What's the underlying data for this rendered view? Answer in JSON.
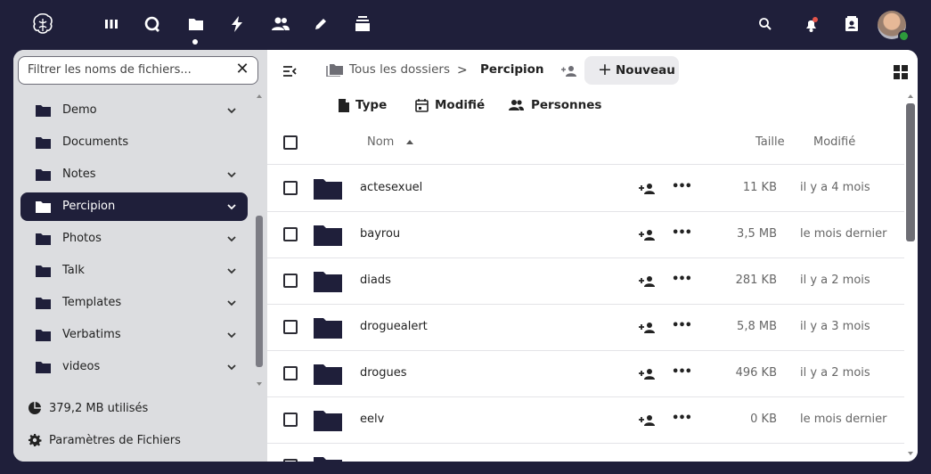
{
  "topbar": {
    "apps": [
      {
        "name": "logo"
      },
      {
        "name": "dashboard"
      },
      {
        "name": "search-unified"
      },
      {
        "name": "files"
      },
      {
        "name": "activity"
      },
      {
        "name": "contacts"
      },
      {
        "name": "notes"
      },
      {
        "name": "deck"
      }
    ],
    "right": [
      "search",
      "notifications",
      "contacts-menu",
      "user-avatar"
    ]
  },
  "sidebar": {
    "filter_placeholder": "Filtrer les noms de fichiers...",
    "items": [
      {
        "label": "Demo",
        "has_children": true
      },
      {
        "label": "Documents",
        "has_children": false
      },
      {
        "label": "Notes",
        "has_children": true
      },
      {
        "label": "Percipion",
        "has_children": true,
        "active": true
      },
      {
        "label": "Photos",
        "has_children": true
      },
      {
        "label": "Talk",
        "has_children": true
      },
      {
        "label": "Templates",
        "has_children": true
      },
      {
        "label": "Verbatims",
        "has_children": true
      },
      {
        "label": "videos",
        "has_children": true
      }
    ],
    "quota": "379,2 MB utilisés",
    "settings": "Paramètres de Fichiers"
  },
  "breadcrumb": {
    "root": "Tous les dossiers",
    "separator": ">",
    "current": "Percipion",
    "new_button": "Nouveau",
    "new_plus": "+"
  },
  "filters": {
    "type": "Type",
    "modified": "Modifié",
    "people": "Personnes"
  },
  "table": {
    "headers": {
      "name": "Nom",
      "size": "Taille",
      "modified": "Modifié"
    },
    "rows": [
      {
        "name": "actesexuel",
        "size": "11 KB",
        "modified": "il y a 4 mois"
      },
      {
        "name": "bayrou",
        "size": "3,5 MB",
        "modified": "le mois dernier"
      },
      {
        "name": "diads",
        "size": "281 KB",
        "modified": "il y a 2 mois"
      },
      {
        "name": "droguealert",
        "size": "5,8 MB",
        "modified": "il y a 3 mois"
      },
      {
        "name": "drogues",
        "size": "496 KB",
        "modified": "il y a 2 mois"
      },
      {
        "name": "eelv",
        "size": "0 KB",
        "modified": "le mois dernier"
      }
    ],
    "more_label": "•••"
  },
  "colors": {
    "header_bg": "#1f1f3a",
    "sidebar_bg": "#dcdde0",
    "active_item_bg": "#1f1f3a",
    "folder": "#1f1f3a",
    "status_online": "#2d9a3c"
  }
}
